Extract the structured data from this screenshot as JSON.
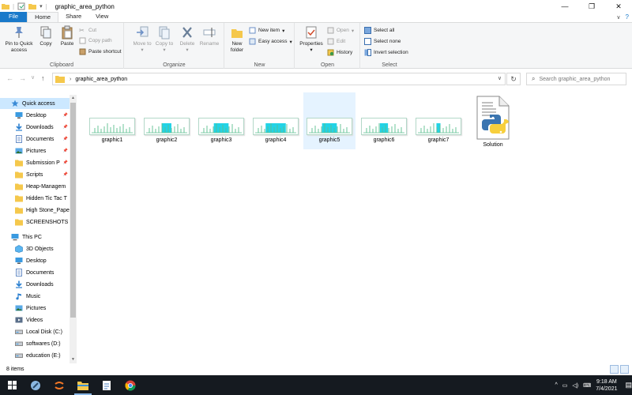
{
  "window": {
    "title": "graphic_area_python",
    "controls": [
      "—",
      "❐",
      "✕"
    ]
  },
  "ribbon": {
    "tabs": [
      "File",
      "Home",
      "Share",
      "View"
    ],
    "clipboard": {
      "label": "Clipboard",
      "pin": "Pin to Quick access",
      "copy": "Copy",
      "paste": "Paste",
      "cut": "Cut",
      "copy_path": "Copy path",
      "paste_shortcut": "Paste shortcut"
    },
    "organize": {
      "label": "Organize",
      "move_to": "Move to",
      "copy_to": "Copy to",
      "delete": "Delete",
      "rename": "Rename"
    },
    "new": {
      "label": "New",
      "new_folder": "New folder",
      "new_item": "New item",
      "easy_access": "Easy access"
    },
    "open": {
      "label": "Open",
      "properties": "Properties",
      "open": "Open",
      "edit": "Edit",
      "history": "History"
    },
    "select": {
      "label": "Select",
      "select_all": "Select all",
      "select_none": "Select none",
      "invert": "Invert selection"
    }
  },
  "navbar": {
    "path": "graphic_area_python",
    "search_placeholder": "Search graphic_area_python"
  },
  "sidebar": {
    "items": [
      {
        "label": "Quick access",
        "icon": "star-icon",
        "pinned": false,
        "selected": true,
        "indent": false
      },
      {
        "label": "Desktop",
        "icon": "desktop-icon",
        "pinned": true,
        "indent": true
      },
      {
        "label": "Downloads",
        "icon": "download-icon",
        "pinned": true,
        "indent": true
      },
      {
        "label": "Documents",
        "icon": "documents-icon",
        "pinned": true,
        "indent": true
      },
      {
        "label": "Pictures",
        "icon": "pictures-icon",
        "pinned": true,
        "indent": true
      },
      {
        "label": "Submission P",
        "icon": "folder-icon",
        "pinned": true,
        "indent": true
      },
      {
        "label": "Scripts",
        "icon": "folder-icon",
        "pinned": true,
        "indent": true
      },
      {
        "label": "Heap-Managem",
        "icon": "folder-icon",
        "pinned": false,
        "indent": true
      },
      {
        "label": "Hidden Tic Tac T",
        "icon": "folder-icon",
        "pinned": false,
        "indent": true
      },
      {
        "label": "High Stone_Pape",
        "icon": "folder-icon",
        "pinned": false,
        "indent": true
      },
      {
        "label": "SCREENSHOTS",
        "icon": "folder-icon",
        "pinned": false,
        "indent": true
      },
      {
        "label": "This PC",
        "icon": "pc-icon",
        "pinned": false,
        "indent": false
      },
      {
        "label": "3D Objects",
        "icon": "3d-objects-icon",
        "pinned": false,
        "indent": true
      },
      {
        "label": "Desktop",
        "icon": "desktop-icon",
        "pinned": false,
        "indent": true
      },
      {
        "label": "Documents",
        "icon": "documents-icon",
        "pinned": false,
        "indent": true
      },
      {
        "label": "Downloads",
        "icon": "download-icon",
        "pinned": false,
        "indent": true
      },
      {
        "label": "Music",
        "icon": "music-icon",
        "pinned": false,
        "indent": true
      },
      {
        "label": "Pictures",
        "icon": "pictures-icon",
        "pinned": false,
        "indent": true
      },
      {
        "label": "Videos",
        "icon": "videos-icon",
        "pinned": false,
        "indent": true
      },
      {
        "label": "Local Disk (C:)",
        "icon": "drive-icon",
        "pinned": false,
        "indent": true
      },
      {
        "label": "softwares (D:)",
        "icon": "drive-icon",
        "pinned": false,
        "indent": true
      },
      {
        "label": "education (E:)",
        "icon": "drive-icon",
        "pinned": false,
        "indent": true
      }
    ]
  },
  "files": [
    {
      "name": "graphic1",
      "type": "image",
      "fill": 0.0
    },
    {
      "name": "graphic2",
      "type": "image",
      "fill": 0.35
    },
    {
      "name": "graphic3",
      "type": "image",
      "fill": 0.55
    },
    {
      "name": "graphic4",
      "type": "image",
      "fill": 0.75
    },
    {
      "name": "graphic5",
      "type": "image",
      "fill": 0.55,
      "selected": true
    },
    {
      "name": "graphic6",
      "type": "image",
      "fill": 0.3
    },
    {
      "name": "graphic7",
      "type": "image",
      "fill": 0.15
    },
    {
      "name": "Solution",
      "type": "python"
    }
  ],
  "status": {
    "count": "8 items"
  },
  "taskbar": {
    "time": "9:18 AM",
    "date": "7/4/2021"
  },
  "colors": {
    "accent": "#1979ca",
    "selection": "#cce8ff",
    "chart_bar": "#22d3e6"
  }
}
